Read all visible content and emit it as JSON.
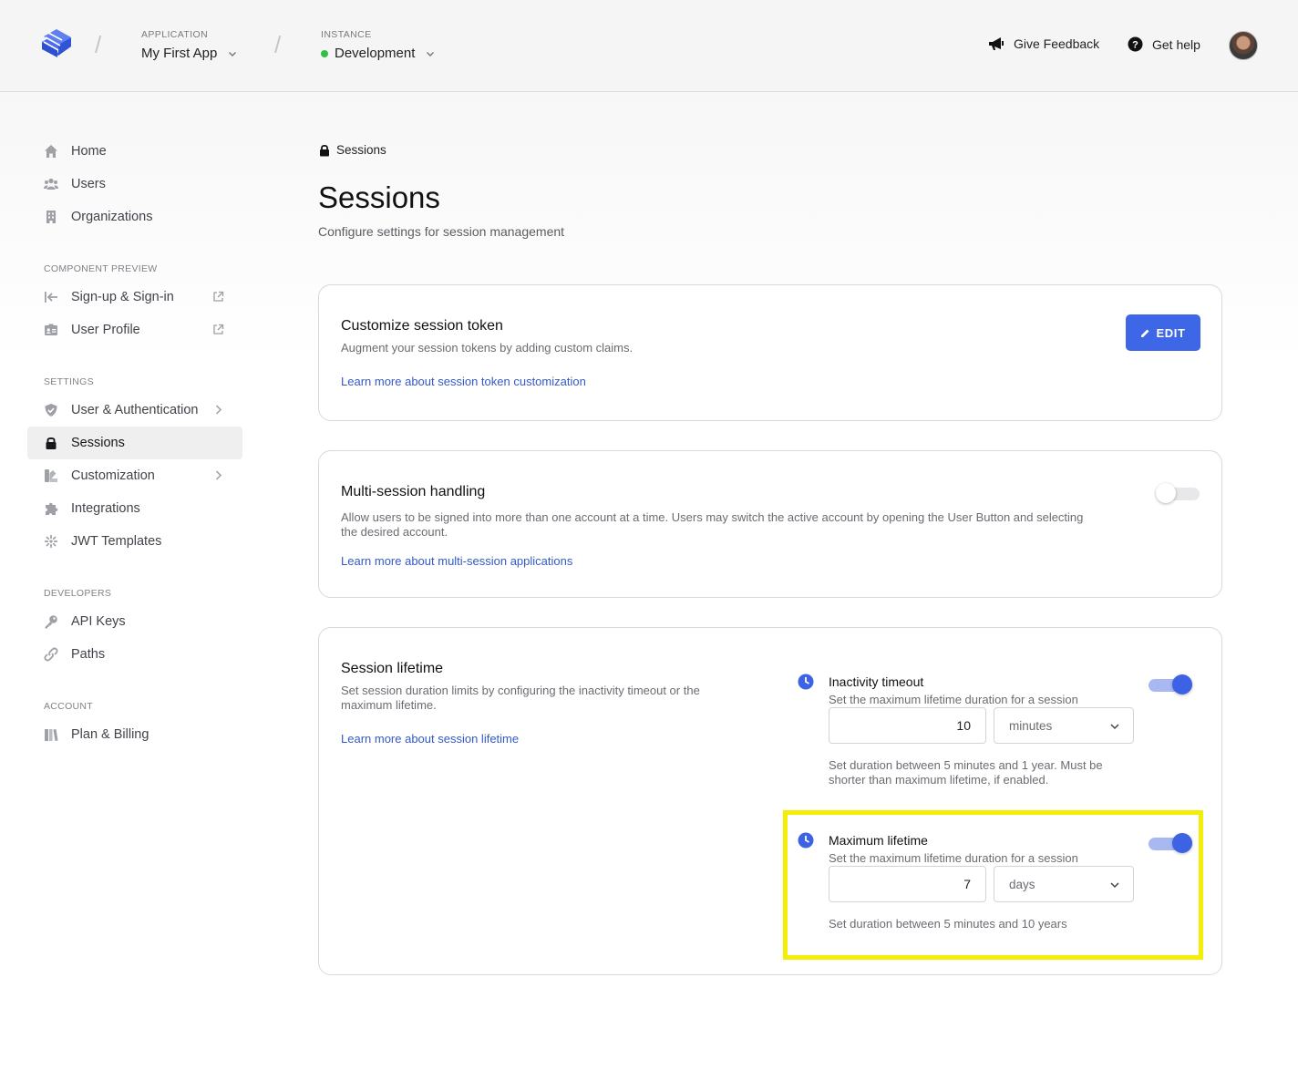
{
  "header": {
    "application_caption": "APPLICATION",
    "application_name": "My First App",
    "instance_caption": "INSTANCE",
    "instance_name": "Development",
    "feedback_label": "Give Feedback",
    "help_label": "Get help",
    "instance_status_color": "#2fbf45"
  },
  "sidebar": {
    "main_items": [
      {
        "label": "Home",
        "icon": "home-icon"
      },
      {
        "label": "Users",
        "icon": "users-icon"
      },
      {
        "label": "Organizations",
        "icon": "building-icon"
      }
    ],
    "component_preview_caption": "COMPONENT PREVIEW",
    "component_items": [
      {
        "label": "Sign-up & Sign-in",
        "icon": "sign-in-icon"
      },
      {
        "label": "User Profile",
        "icon": "id-card-icon"
      }
    ],
    "settings_caption": "SETTINGS",
    "settings_items": [
      {
        "label": "User & Authentication",
        "icon": "shield-icon"
      },
      {
        "label": "Sessions",
        "icon": "lock-icon",
        "active": true
      },
      {
        "label": "Customization",
        "icon": "palette-icon"
      },
      {
        "label": "Integrations",
        "icon": "puzzle-icon"
      },
      {
        "label": "JWT Templates",
        "icon": "jwt-icon"
      }
    ],
    "developers_caption": "DEVELOPERS",
    "developer_items": [
      {
        "label": "API Keys",
        "icon": "key-icon"
      },
      {
        "label": "Paths",
        "icon": "link-icon"
      }
    ],
    "account_caption": "ACCOUNT",
    "account_items": [
      {
        "label": "Plan & Billing",
        "icon": "billing-icon"
      }
    ]
  },
  "main": {
    "breadcrumb": "Sessions",
    "title": "Sessions",
    "subtitle": "Configure settings for session management",
    "token_card": {
      "title": "Customize session token",
      "description": "Augment your session tokens by adding custom claims.",
      "link": "Learn more about session token customization",
      "edit_label": "EDIT"
    },
    "multi_card": {
      "title": "Multi-session handling",
      "description": "Allow users to be signed into more than one account at a time. Users may switch the active account by opening the User Button and selecting the desired account.",
      "link": "Learn more about multi-session applications",
      "enabled": false
    },
    "lifetime_card": {
      "title": "Session lifetime",
      "description": "Set session duration limits by configuring the inactivity timeout or the maximum lifetime.",
      "link": "Learn more about session lifetime",
      "inactivity": {
        "title": "Inactivity timeout",
        "description": "Set the maximum lifetime duration for a session",
        "value": "10",
        "unit": "minutes",
        "help": "Set duration between 5 minutes and 1 year. Must be shorter than maximum lifetime, if enabled.",
        "enabled": true
      },
      "maximum": {
        "title": "Maximum lifetime",
        "description": "Set the maximum lifetime duration for a session",
        "value": "7",
        "unit": "days",
        "help": "Set duration between 5 minutes and 10 years",
        "enabled": true
      }
    }
  },
  "colors": {
    "accent": "#3d67e6",
    "link": "#3459c8",
    "highlight": "#f2ee05"
  }
}
